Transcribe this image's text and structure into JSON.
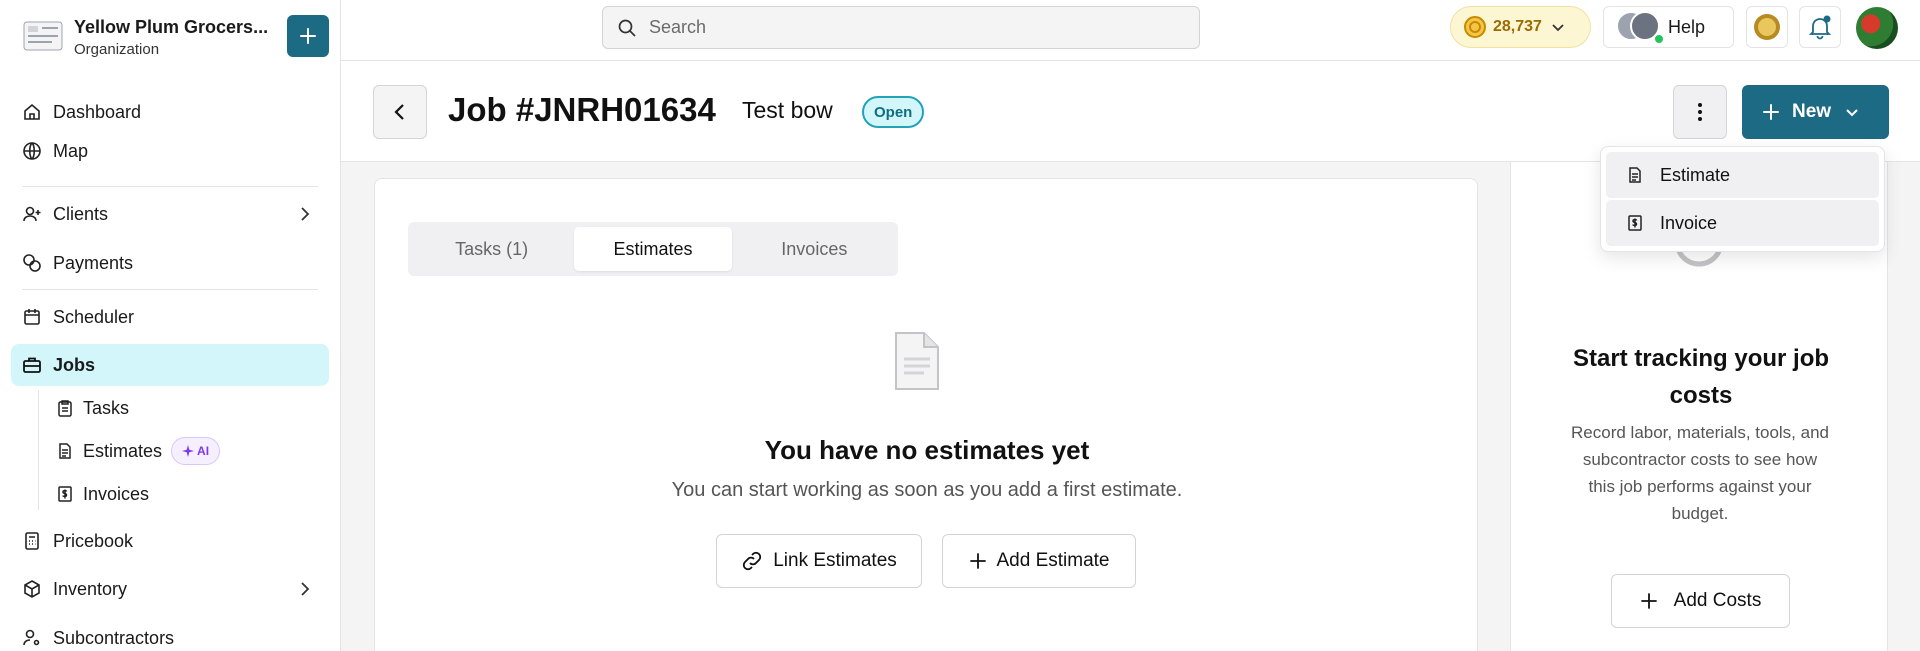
{
  "org": {
    "name": "Yellow Plum Grocers...",
    "type": "Organization"
  },
  "nav": {
    "dashboard": "Dashboard",
    "map": "Map",
    "clients": "Clients",
    "payments": "Payments",
    "scheduler": "Scheduler",
    "jobs": "Jobs",
    "tasks": "Tasks",
    "estimates": "Estimates",
    "estimates_badge": "AI",
    "invoices": "Invoices",
    "pricebook": "Pricebook",
    "inventory": "Inventory",
    "subcontractors": "Subcontractors"
  },
  "topbar": {
    "search_placeholder": "Search",
    "coins": "28,737",
    "help": "Help"
  },
  "job": {
    "title": "Job #JNRH01634",
    "name": "Test bow",
    "status": "Open",
    "new_label": "New"
  },
  "tabs": [
    {
      "label": "Tasks (1)"
    },
    {
      "label": "Estimates"
    },
    {
      "label": "Invoices"
    }
  ],
  "empty": {
    "title": "You have no estimates yet",
    "subtitle": "You can start working as soon as you add a first estimate.",
    "link_label": "Link Estimates",
    "add_label": "Add Estimate"
  },
  "costs": {
    "title": "Start tracking your job costs",
    "text": "Record labor, materials, tools, and subcontractor costs to see how this job performs against your budget.",
    "button": "Add Costs"
  },
  "dropdown": {
    "estimate": "Estimate",
    "invoice": "Invoice"
  },
  "colors": {
    "primary": "#1d6a85",
    "active_nav": "#d3f6fb",
    "status_border": "#22a3b8",
    "ai_badge": "#7c3aed"
  }
}
